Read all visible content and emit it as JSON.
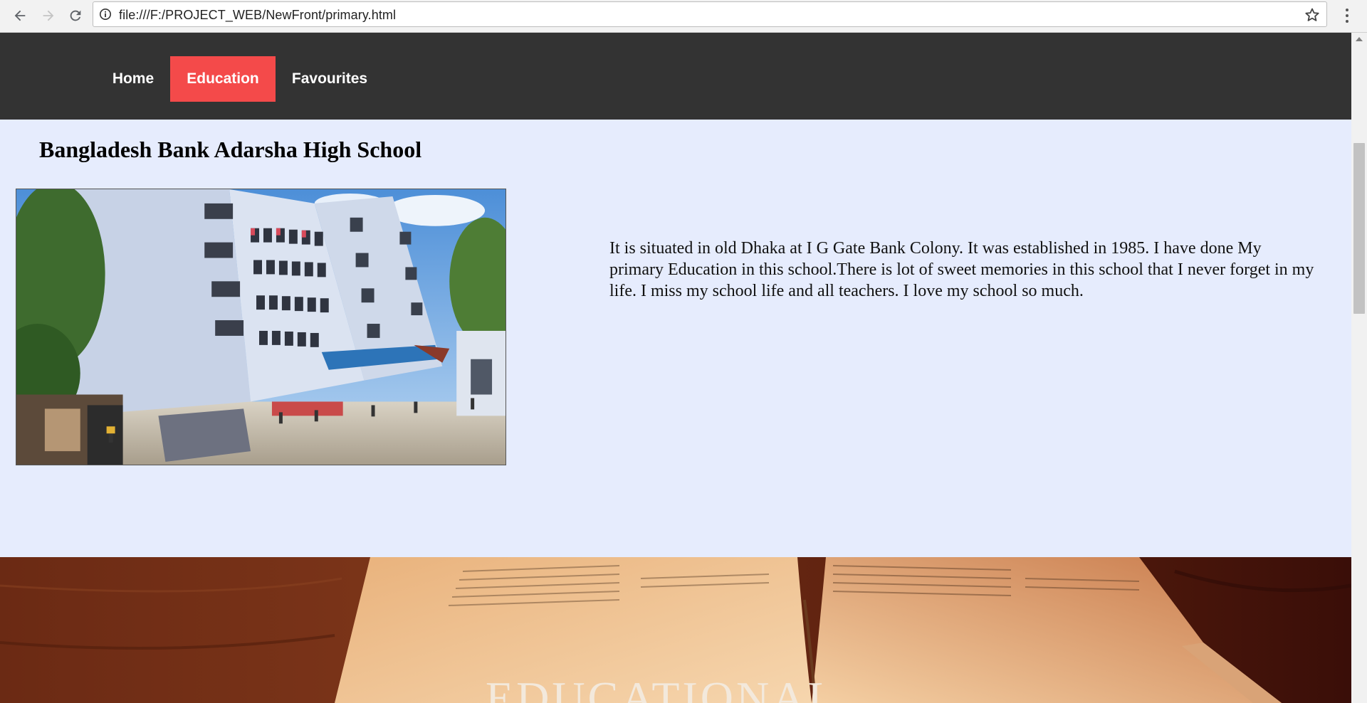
{
  "browser": {
    "url": "file:///F:/PROJECT_WEB/NewFront/primary.html",
    "icons": {
      "back": "arrow-left-icon",
      "forward": "arrow-right-icon",
      "reload": "reload-icon",
      "info": "info-icon",
      "bookmark": "star-icon",
      "menu": "vertical-dots-icon"
    }
  },
  "nav": {
    "items": [
      {
        "label": "Home",
        "active": false
      },
      {
        "label": "Education",
        "active": true
      },
      {
        "label": "Favourites",
        "active": false
      }
    ],
    "colors": {
      "bar": "#333333",
      "active": "#f44a4a",
      "text": "#ffffff"
    }
  },
  "main": {
    "title": "Bangladesh Bank Adarsha High School",
    "description": "It is situated in old Dhaka at I G Gate Bank Colony. It was established in 1985. I have done My primary Education in this school.There is lot of sweet memories in this school that I never forget in my life. I miss my school life and all teachers. I love my school so much.",
    "background": "#e6ecfd"
  },
  "hero": {
    "title": "EDUCATIONAL"
  }
}
